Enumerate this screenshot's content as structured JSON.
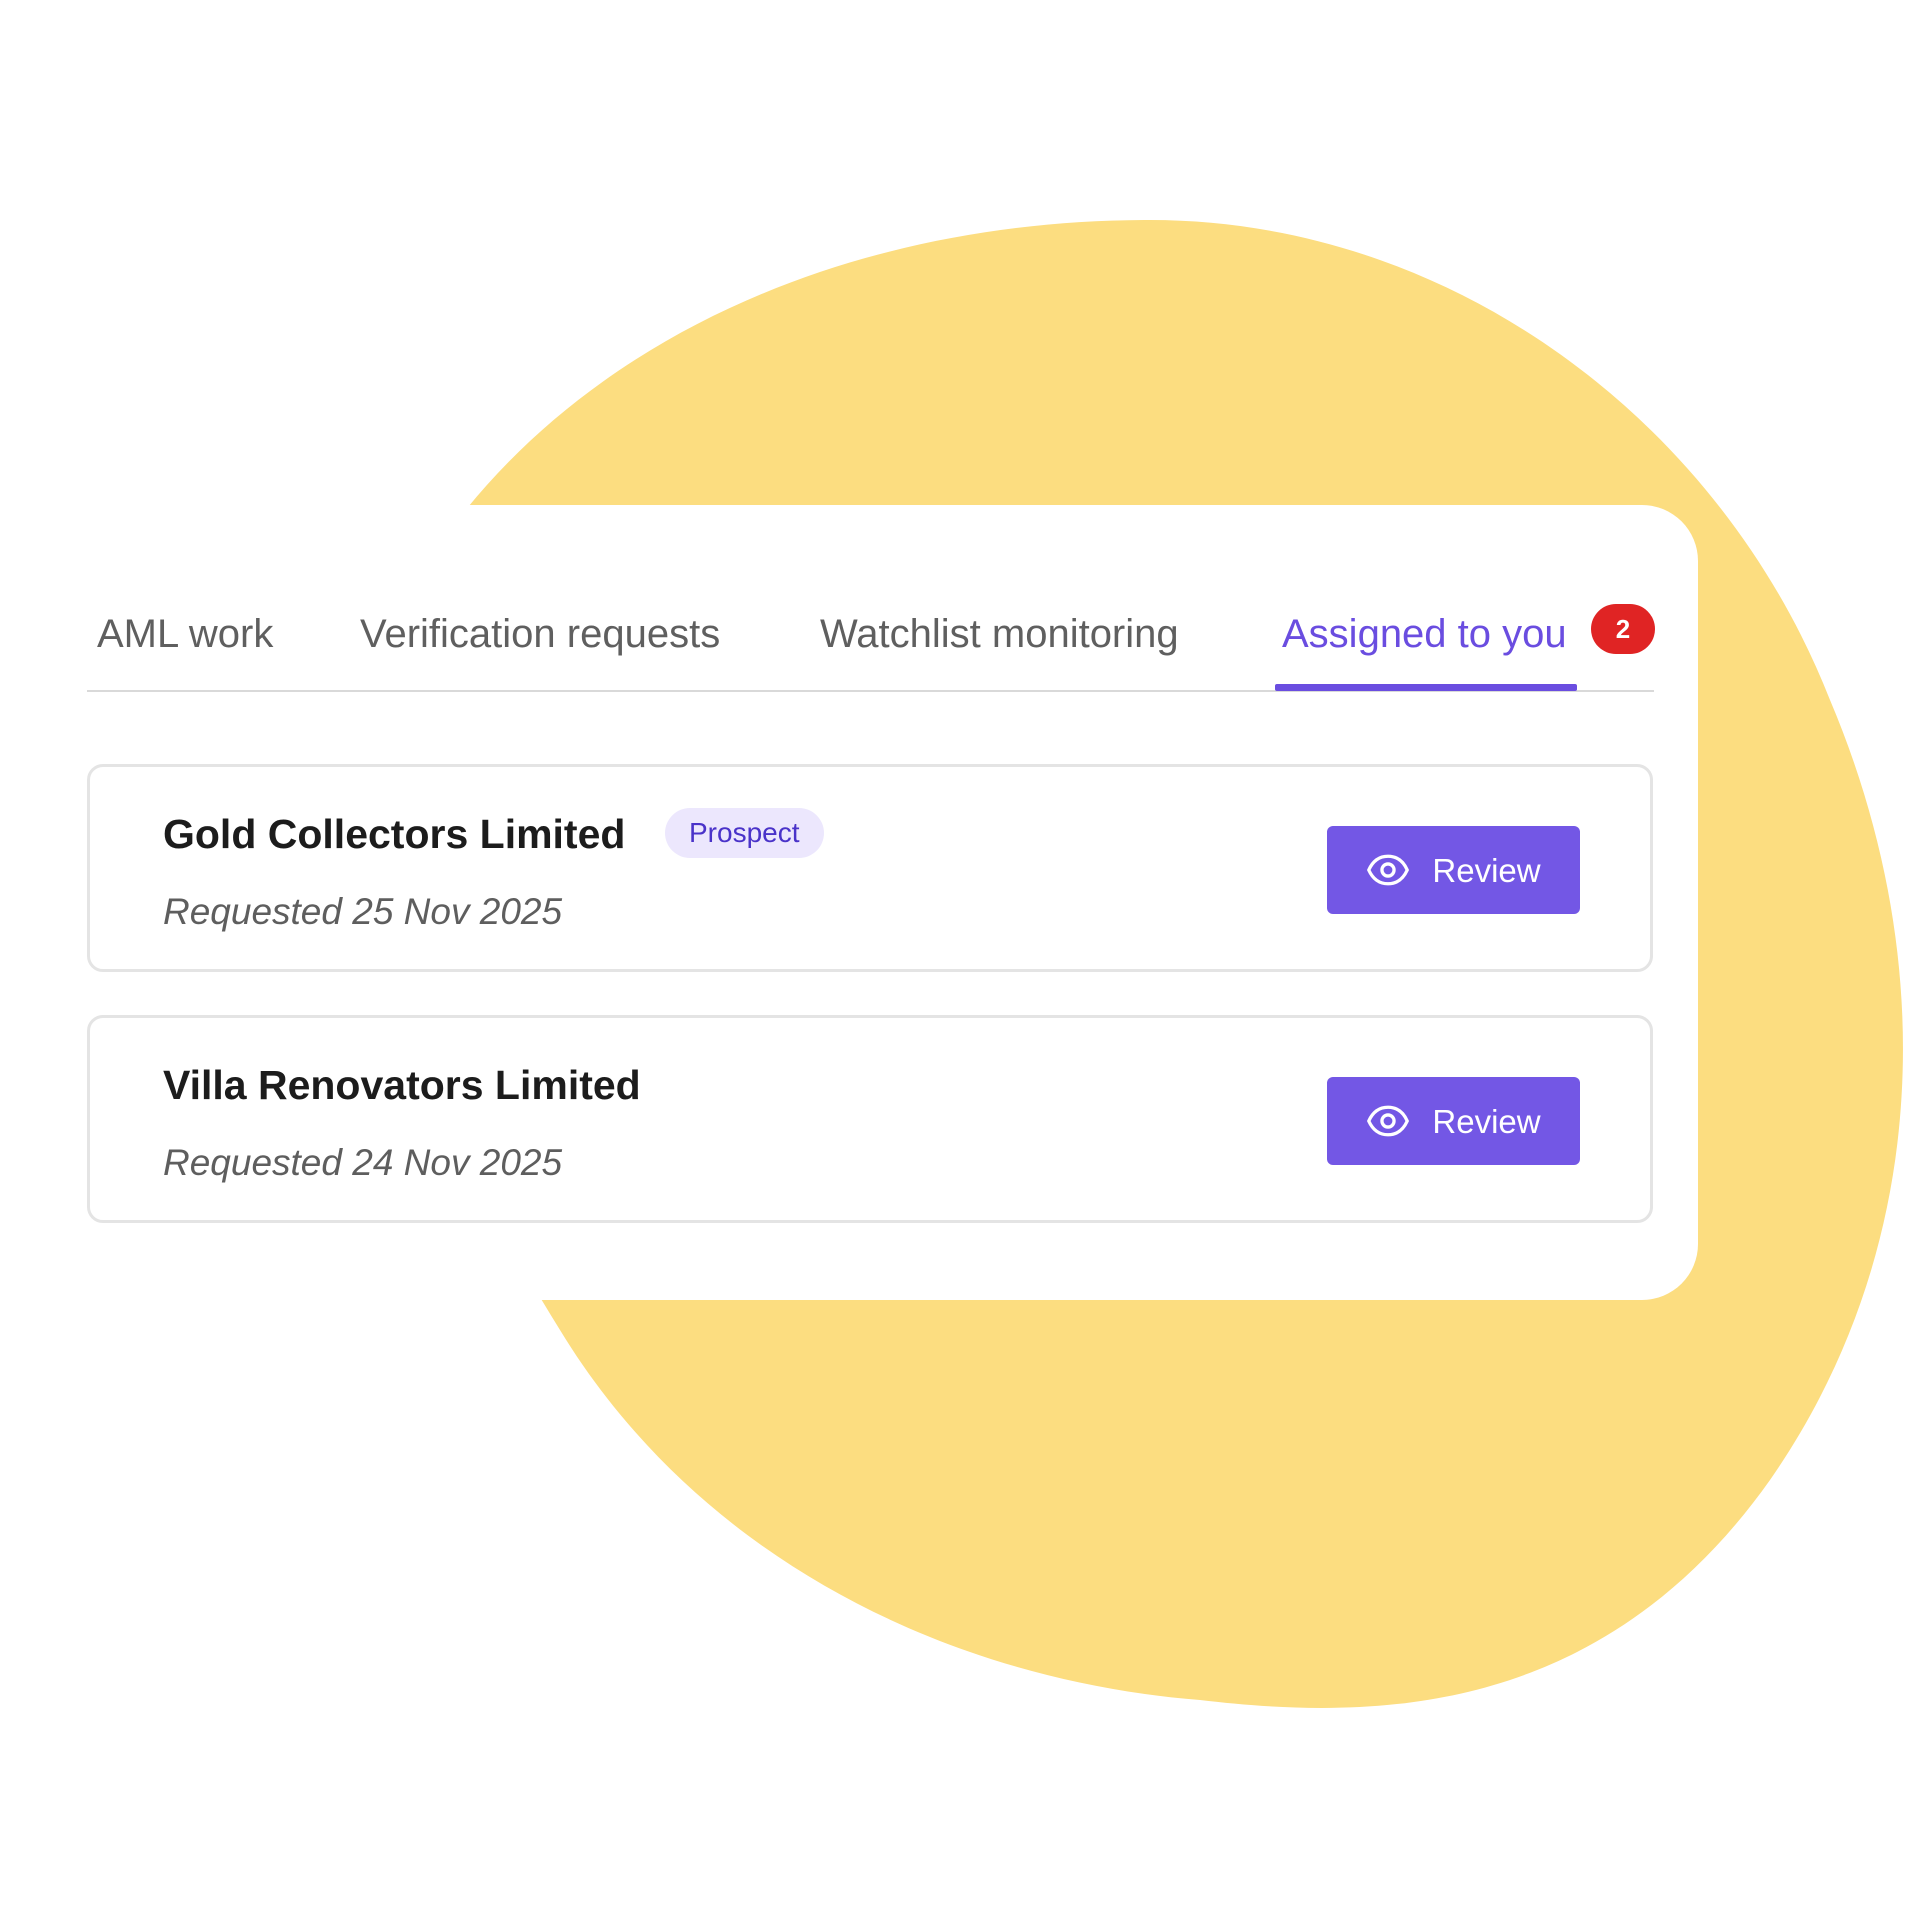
{
  "tabs": [
    {
      "label": "AML work",
      "active": false
    },
    {
      "label": "Verification requests",
      "active": false
    },
    {
      "label": "Watchlist monitoring",
      "active": false
    },
    {
      "label": "Assigned to you",
      "active": true,
      "count": "2"
    }
  ],
  "requests": [
    {
      "company": "Gold Collectors Limited",
      "tag": "Prospect",
      "requested": "Requested 25 Nov 2025",
      "action_label": "Review",
      "action_icon": "eye-icon"
    },
    {
      "company": "Villa Renovators Limited",
      "tag": "",
      "requested": "Requested 24 Nov 2025",
      "action_label": "Review",
      "action_icon": "eye-icon"
    }
  ],
  "colors": {
    "background_blob": "#fcdd80",
    "accent": "#6a4de0",
    "button": "#7357e5",
    "badge": "#e02424",
    "tag_bg": "#ece7fd",
    "tag_text": "#4a33c9"
  }
}
